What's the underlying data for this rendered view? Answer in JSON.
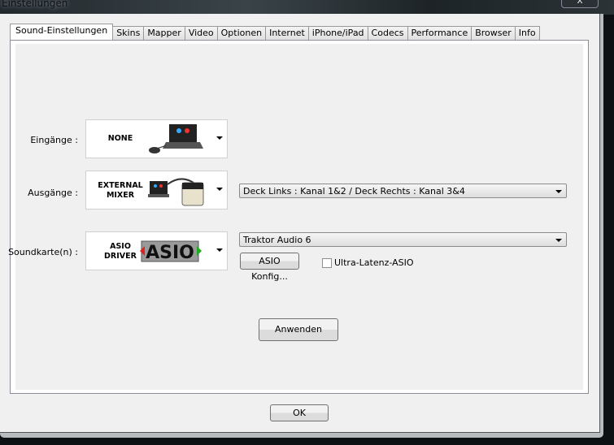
{
  "window": {
    "title": "Einstellungen",
    "close_label": "X"
  },
  "tabs": [
    {
      "label": "Sound-Einstellungen",
      "active": true
    },
    {
      "label": "Skins"
    },
    {
      "label": "Mapper"
    },
    {
      "label": "Video"
    },
    {
      "label": "Optionen"
    },
    {
      "label": "Internet"
    },
    {
      "label": "iPhone/iPad"
    },
    {
      "label": "Codecs"
    },
    {
      "label": "Performance"
    },
    {
      "label": "Browser"
    },
    {
      "label": "Info"
    }
  ],
  "inputs": {
    "label": "Eingänge :",
    "card_text": "NONE"
  },
  "outputs": {
    "label": "Ausgänge :",
    "card_line1": "EXTERNAL",
    "card_line2": "MIXER",
    "select_value": "Deck Links : Kanal 1&2 / Deck Rechts : Kanal 3&4"
  },
  "soundcard": {
    "label": "Soundkarte(n) :",
    "card_line1": "ASIO",
    "card_line2": "DRIVER",
    "logo_text": "ASIO",
    "select_value": "Traktor Audio 6",
    "config_button": "ASIO Konfig...",
    "ultra_latency_label": "Ultra-Latenz-ASIO",
    "ultra_latency_checked": false
  },
  "apply_button": "Anwenden",
  "ok_button": "OK"
}
